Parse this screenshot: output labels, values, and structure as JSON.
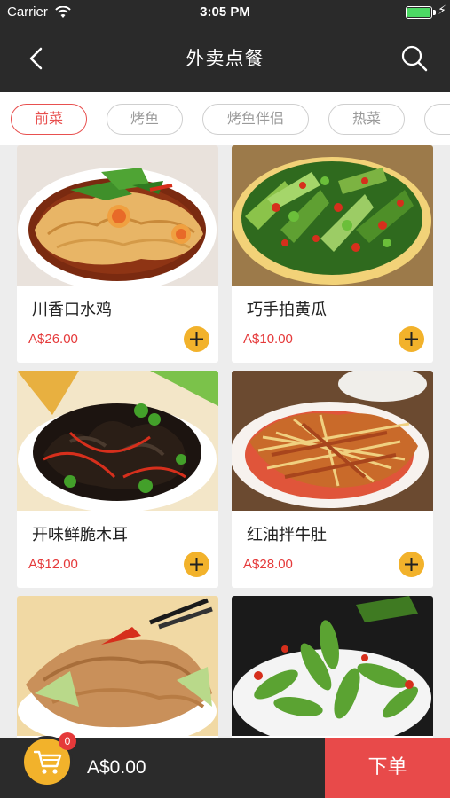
{
  "status_bar": {
    "carrier": "Carrier",
    "time": "3:05 PM"
  },
  "nav": {
    "title": "外卖点餐",
    "back_icon": "chevron-left-icon",
    "search_icon": "search-icon"
  },
  "categories": [
    {
      "label": "前菜",
      "active": true
    },
    {
      "label": "烤鱼",
      "active": false
    },
    {
      "label": "烤鱼伴侣",
      "active": false
    },
    {
      "label": "热菜",
      "active": false
    }
  ],
  "dishes": [
    {
      "name": "川香口水鸡",
      "price": "A$26.00"
    },
    {
      "name": "巧手拍黄瓜",
      "price": "A$10.00"
    },
    {
      "name": "开味鲜脆木耳",
      "price": "A$12.00"
    },
    {
      "name": "红油拌牛肚",
      "price": "A$28.00"
    },
    {
      "name": "",
      "price": ""
    },
    {
      "name": "",
      "price": ""
    }
  ],
  "cart": {
    "count": "0",
    "total": "A$0.00",
    "icon": "cart-icon"
  },
  "order_button": {
    "label": "下单"
  },
  "colors": {
    "accent": "#e8504f",
    "button_yellow": "#f2b22b",
    "dark_bar": "#2a2a2a",
    "price_red": "#e5393a"
  }
}
